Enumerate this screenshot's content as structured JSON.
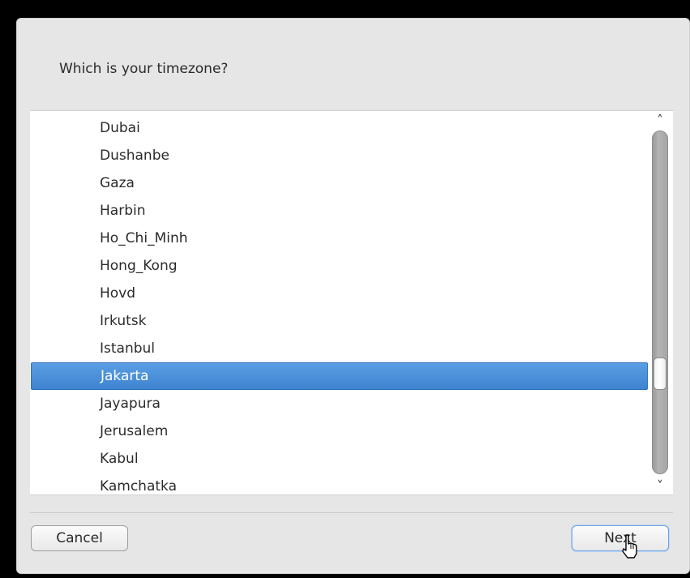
{
  "dialog": {
    "question": "Which is your timezone?"
  },
  "timezone_list": {
    "items": [
      {
        "label": "Dubai",
        "selected": false
      },
      {
        "label": "Dushanbe",
        "selected": false
      },
      {
        "label": "Gaza",
        "selected": false
      },
      {
        "label": "Harbin",
        "selected": false
      },
      {
        "label": "Ho_Chi_Minh",
        "selected": false
      },
      {
        "label": "Hong_Kong",
        "selected": false
      },
      {
        "label": "Hovd",
        "selected": false
      },
      {
        "label": "Irkutsk",
        "selected": false
      },
      {
        "label": "Istanbul",
        "selected": false
      },
      {
        "label": "Jakarta",
        "selected": true
      },
      {
        "label": "Jayapura",
        "selected": false
      },
      {
        "label": "Jerusalem",
        "selected": false
      },
      {
        "label": "Kabul",
        "selected": false
      },
      {
        "label": "Kamchatka",
        "selected": false
      }
    ],
    "scroll_position": 0.73,
    "scroll_up_icon": "chevron-up-icon",
    "scroll_down_icon": "chevron-down-icon"
  },
  "buttons": {
    "cancel_label": "Cancel",
    "next_label": "Next"
  },
  "colors": {
    "selection": "#4a90dc",
    "dialog_bg": "#e6e6e6"
  }
}
